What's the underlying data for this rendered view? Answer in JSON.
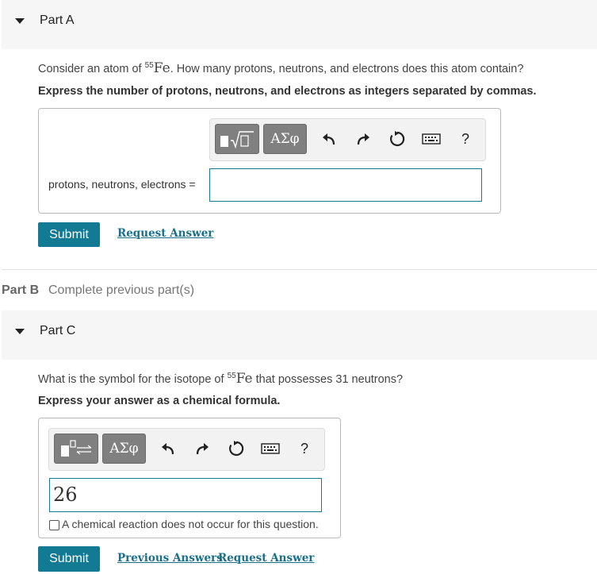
{
  "partA": {
    "label": "Part A",
    "question_pre": "Consider an atom of ",
    "isotope_mass": "55",
    "isotope_symbol": "Fe",
    "question_post": ". How many protons, neutrons, and electrons does this atom contain?",
    "instruction": "Express the number of protons, neutrons, and electrons as integers separated by commas.",
    "toolbar": {
      "templates_icon": "matrix-root-template-icon",
      "greek_label": "ΑΣφ",
      "help_label": "?"
    },
    "answer_label": "protons, neutrons, electrons =",
    "answer_value": "",
    "submit_label": "Submit",
    "request_label": "Request Answer"
  },
  "partB": {
    "label": "Part B",
    "status": "Complete previous part(s)"
  },
  "partC": {
    "label": "Part C",
    "question_pre": "What is the symbol for the isotope of ",
    "isotope_mass": "55",
    "isotope_symbol": "Fe",
    "question_post": " that possesses 31 neutrons?",
    "instruction": "Express your answer as a chemical formula.",
    "toolbar": {
      "templates_icon": "subscript-arrow-template-icon",
      "greek_label": "ΑΣφ",
      "help_label": "?"
    },
    "answer_value": "26",
    "checkbox_label": "A chemical reaction does not occur for this question.",
    "submit_label": "Submit",
    "previous_label": "Previous Answers",
    "request_label": "Request Answer"
  },
  "colors": {
    "accent": "#137a93",
    "header_bg": "#f6f6f6",
    "link": "#1a6f89",
    "tool_dark": "#808080"
  }
}
